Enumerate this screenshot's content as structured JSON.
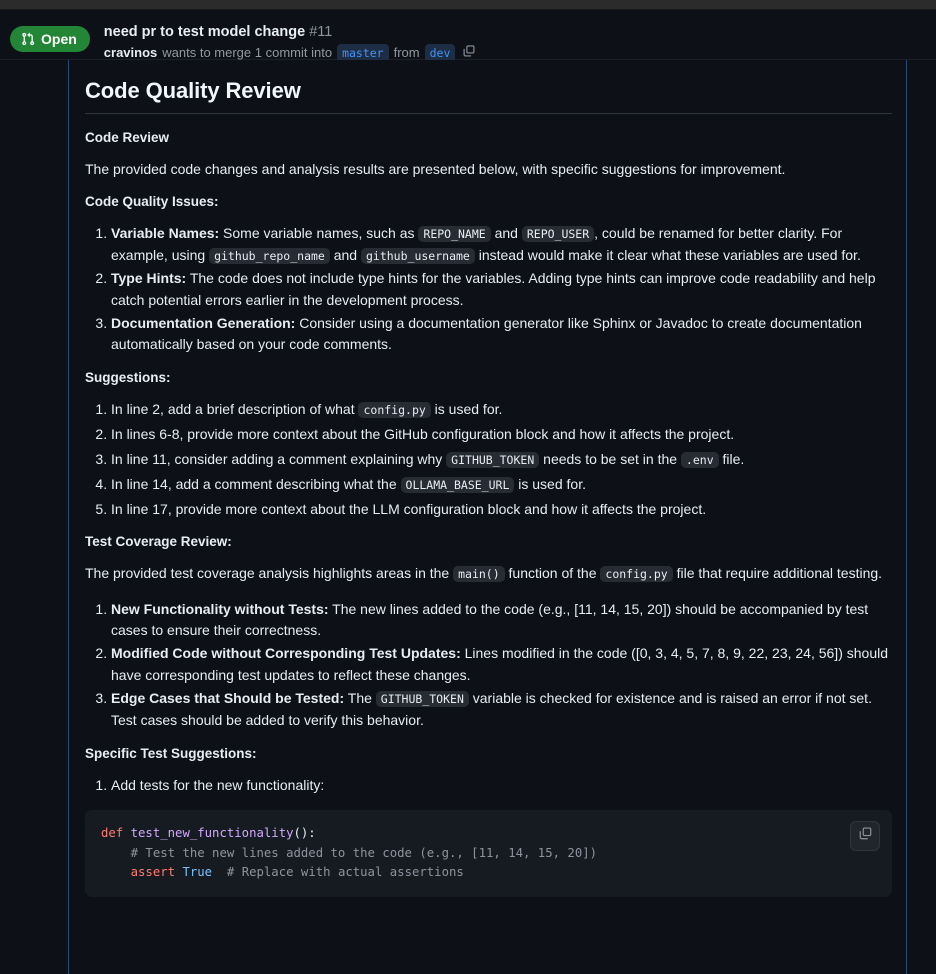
{
  "window": {
    "titlebar_color": "#2b2b2b"
  },
  "pr_header": {
    "state_label": "Open",
    "state_icon": "git-pull-request-icon",
    "state_color": "#238636",
    "title": "need pr to test model change",
    "number": "#11",
    "author": "cravinos",
    "action_text_before": "wants to merge 1 commit into",
    "base_branch": "master",
    "action_text_mid": "from",
    "head_branch": "dev",
    "copy_icon": "copy-icon"
  },
  "review": {
    "title": "Code Quality Review",
    "section_code_review": "Code Review",
    "intro": "The provided code changes and analysis results are presented below, with specific suggestions for improvement.",
    "heading_code_quality_issues": "Code Quality Issues:",
    "code_quality_issues": [
      {
        "lead": "Variable Names:",
        "parts": [
          {
            "t": "text",
            "v": " Some variable names, such as "
          },
          {
            "t": "code",
            "v": "REPO_NAME"
          },
          {
            "t": "text",
            "v": " and "
          },
          {
            "t": "code",
            "v": "REPO_USER"
          },
          {
            "t": "text",
            "v": ", could be renamed for better clarity. For example, using "
          },
          {
            "t": "code",
            "v": "github_repo_name"
          },
          {
            "t": "text",
            "v": " and "
          },
          {
            "t": "code",
            "v": "github_username"
          },
          {
            "t": "text",
            "v": " instead would make it clear what these variables are used for."
          }
        ]
      },
      {
        "lead": "Type Hints:",
        "parts": [
          {
            "t": "text",
            "v": " The code does not include type hints for the variables. Adding type hints can improve code readability and help catch potential errors earlier in the development process."
          }
        ]
      },
      {
        "lead": "Documentation Generation:",
        "parts": [
          {
            "t": "text",
            "v": " Consider using a documentation generator like Sphinx or Javadoc to create documentation automatically based on your code comments."
          }
        ]
      }
    ],
    "heading_suggestions": "Suggestions:",
    "suggestions": [
      {
        "lead": "",
        "parts": [
          {
            "t": "text",
            "v": "In line 2, add a brief description of what "
          },
          {
            "t": "code",
            "v": "config.py"
          },
          {
            "t": "text",
            "v": " is used for."
          }
        ]
      },
      {
        "lead": "",
        "parts": [
          {
            "t": "text",
            "v": "In lines 6-8, provide more context about the GitHub configuration block and how it affects the project."
          }
        ]
      },
      {
        "lead": "",
        "parts": [
          {
            "t": "text",
            "v": "In line 11, consider adding a comment explaining why "
          },
          {
            "t": "code",
            "v": "GITHUB_TOKEN"
          },
          {
            "t": "text",
            "v": " needs to be set in the "
          },
          {
            "t": "code",
            "v": ".env"
          },
          {
            "t": "text",
            "v": " file."
          }
        ]
      },
      {
        "lead": "",
        "parts": [
          {
            "t": "text",
            "v": "In line 14, add a comment describing what the "
          },
          {
            "t": "code",
            "v": "OLLAMA_BASE_URL"
          },
          {
            "t": "text",
            "v": " is used for."
          }
        ]
      },
      {
        "lead": "",
        "parts": [
          {
            "t": "text",
            "v": "In line 17, provide more context about the LLM configuration block and how it affects the project."
          }
        ]
      }
    ],
    "heading_test_coverage": "Test Coverage Review:",
    "test_coverage_intro_parts": [
      {
        "t": "text",
        "v": "The provided test coverage analysis highlights areas in the "
      },
      {
        "t": "code",
        "v": "main()"
      },
      {
        "t": "text",
        "v": " function of the "
      },
      {
        "t": "code",
        "v": "config.py"
      },
      {
        "t": "text",
        "v": " file that require additional testing."
      }
    ],
    "test_coverage_items": [
      {
        "lead": "New Functionality without Tests:",
        "parts": [
          {
            "t": "text",
            "v": " The new lines added to the code (e.g., [11, 14, 15, 20]) should be accompanied by test cases to ensure their correctness."
          }
        ]
      },
      {
        "lead": "Modified Code without Corresponding Test Updates:",
        "parts": [
          {
            "t": "text",
            "v": " Lines modified in the code ([0, 3, 4, 5, 7, 8, 9, 22, 23, 24, 56]) should have corresponding test updates to reflect these changes."
          }
        ]
      },
      {
        "lead": "Edge Cases that Should be Tested:",
        "parts": [
          {
            "t": "text",
            "v": " The "
          },
          {
            "t": "code",
            "v": "GITHUB_TOKEN"
          },
          {
            "t": "text",
            "v": " variable is checked for existence and is raised an error if not set. Test cases should be added to verify this behavior."
          }
        ]
      }
    ],
    "heading_specific_tests": "Specific Test Suggestions:",
    "specific_test_items": [
      {
        "lead": "",
        "parts": [
          {
            "t": "text",
            "v": "Add tests for the new functionality:"
          }
        ]
      }
    ],
    "code_block": {
      "language": "python",
      "copy_icon": "copy-icon",
      "tokens": [
        [
          {
            "k": "kw",
            "v": "def"
          },
          {
            "k": "pl",
            "v": " "
          },
          {
            "k": "fn",
            "v": "test_new_functionality"
          },
          {
            "k": "pl",
            "v": "():"
          }
        ],
        [
          {
            "k": "pl",
            "v": "    "
          },
          {
            "k": "cmt",
            "v": "# Test the new lines added to the code (e.g., [11, 14, 15, 20])"
          }
        ],
        [
          {
            "k": "pl",
            "v": "    "
          },
          {
            "k": "kw",
            "v": "assert"
          },
          {
            "k": "pl",
            "v": " "
          },
          {
            "k": "lit",
            "v": "True"
          },
          {
            "k": "pl",
            "v": "  "
          },
          {
            "k": "cmt",
            "v": "# Replace with actual assertions"
          }
        ]
      ]
    }
  }
}
